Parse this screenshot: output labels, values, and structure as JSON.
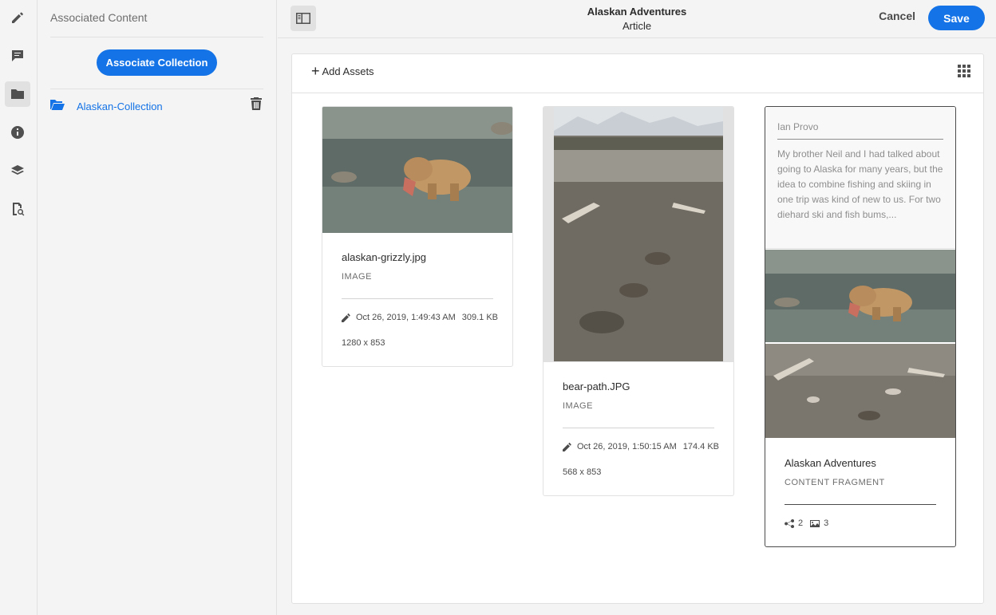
{
  "rail": {
    "items": [
      {
        "icon": "pencil-icon",
        "active": false
      },
      {
        "icon": "comment-icon",
        "active": false
      },
      {
        "icon": "folder-icon",
        "active": true
      },
      {
        "icon": "info-icon",
        "active": false
      },
      {
        "icon": "layers-icon",
        "active": false
      },
      {
        "icon": "search-document-icon",
        "active": false
      }
    ]
  },
  "panel": {
    "title": "Associated Content",
    "associate_button": "Associate Collection",
    "collection": {
      "name": "Alaskan-Collection",
      "icon": "folder-open-icon"
    }
  },
  "header": {
    "title": "Alaskan Adventures",
    "subtitle": "Article",
    "cancel_label": "Cancel",
    "save_label": "Save"
  },
  "toolbar": {
    "add_assets_label": "Add Assets"
  },
  "cards": [
    {
      "name": "alaskan-grizzly.jpg",
      "type": "IMAGE",
      "modified": "Oct 26, 2019, 1:49:43 AM",
      "size": "309.1 KB",
      "dimensions": "1280 x 853"
    },
    {
      "name": "bear-path.JPG",
      "type": "IMAGE",
      "modified": "Oct 26, 2019, 1:50:15 AM",
      "size": "174.4 KB",
      "dimensions": "568 x 853"
    },
    {
      "name": "Alaskan Adventures",
      "type": "CONTENT FRAGMENT",
      "author": "Ian Provo",
      "excerpt": "My brother Neil and I had talked about going to Alaska for many years, but the idea to combine fishing and skiing in one trip was kind of new to us. For two diehard ski and fish bums,...",
      "references": "2",
      "images": "3"
    }
  ],
  "colors": {
    "accent": "#1473e6",
    "rail_bg": "#f4f4f4",
    "selected_border": "#4b4b4b"
  }
}
